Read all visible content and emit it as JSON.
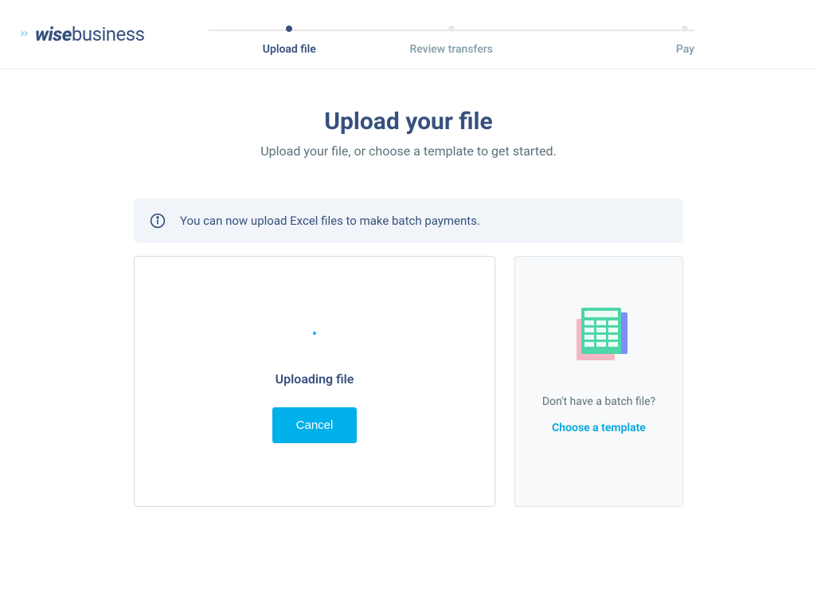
{
  "logo": {
    "wise": "wise",
    "business": "business"
  },
  "stepper": {
    "steps": [
      {
        "label": "Upload file",
        "active": true
      },
      {
        "label": "Review transfers",
        "active": false
      },
      {
        "label": "Pay",
        "active": false
      }
    ]
  },
  "page": {
    "title": "Upload your file",
    "subtitle": "Upload your file, or choose a template to get started."
  },
  "info_banner": {
    "text": "You can now upload Excel files to make batch payments."
  },
  "upload": {
    "status": "Uploading file",
    "cancel_label": "Cancel"
  },
  "template": {
    "prompt": "Don't have a batch file?",
    "link_label": "Choose a template"
  }
}
